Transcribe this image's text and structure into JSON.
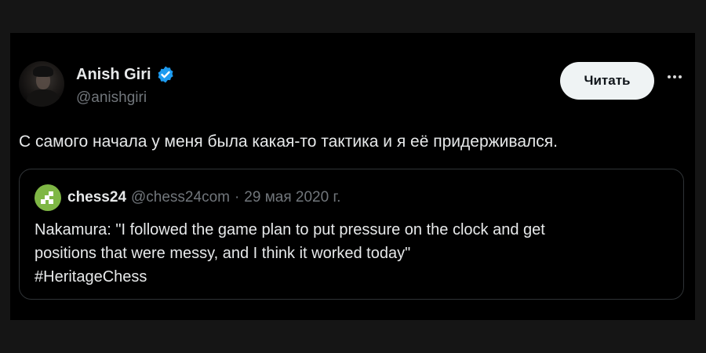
{
  "author": {
    "name": "Anish Giri",
    "handle": "@anishgiri",
    "verified": true,
    "verified_color": "#1d9bf0"
  },
  "follow_button": "Читать",
  "more_icon": "ellipsis-icon",
  "tweet": {
    "text": "С самого начала у меня была какая-то тактика и я её придерживался."
  },
  "quoted_tweet": {
    "name": "chess24",
    "handle": "@chess24com",
    "separator": "·",
    "date": "29 мая 2020 г.",
    "avatar_color": "#7fb745",
    "lines": [
      "Nakamura: \"I followed the game plan to put pressure on the clock and get",
      "positions that were messy, and I think it worked today\"",
      "#HeritageChess"
    ]
  }
}
